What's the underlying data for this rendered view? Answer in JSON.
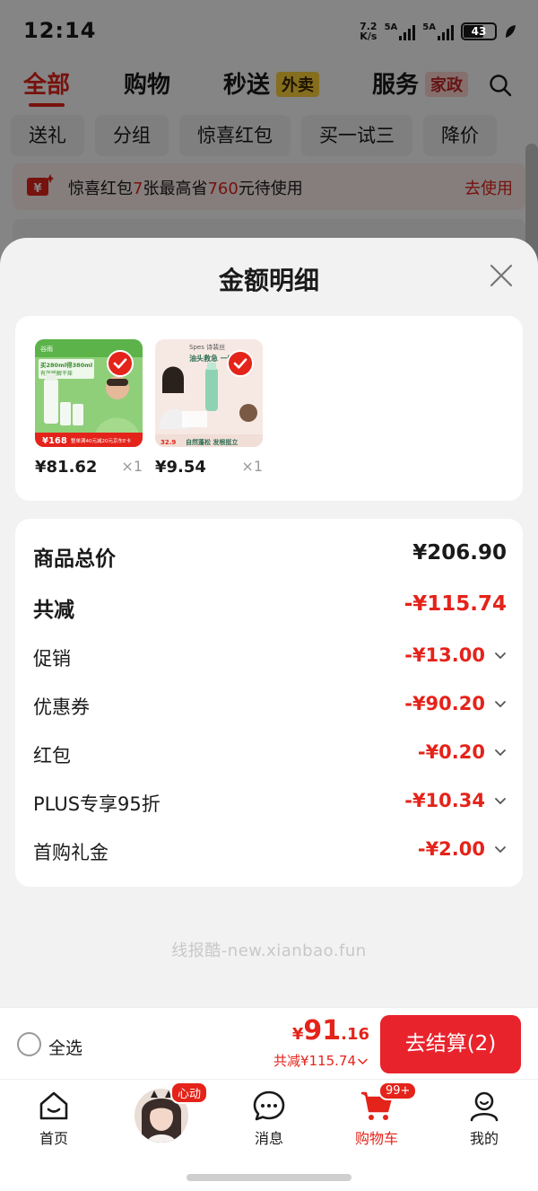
{
  "status_bar": {
    "time": "12:14",
    "net_speed_value": "7.2",
    "net_speed_unit": "K/s",
    "signal1": "5A",
    "signal2": "5A",
    "battery": "43"
  },
  "top_tabs": [
    {
      "label": "全部"
    },
    {
      "label": "购物"
    },
    {
      "label": "秒送"
    },
    {
      "label": "服务"
    }
  ],
  "tab_tags": {
    "waimai": "外卖",
    "jiazheng": "家政"
  },
  "chips": [
    "送礼",
    "分组",
    "惊喜红包",
    "买一试三",
    "降价"
  ],
  "coupon_bar": {
    "text_a": "惊喜红包",
    "count": "7",
    "text_b": "张最高省",
    "amount": "760",
    "text_c": "元待使用",
    "action": "去使用"
  },
  "sheet": {
    "title": "金额明细"
  },
  "goods": [
    {
      "price": "¥81.62",
      "qty": "×1"
    },
    {
      "price": "¥9.54",
      "qty": "×1"
    }
  ],
  "goods_img_text": {
    "g1_brand": "谷雨",
    "g1_line1": "买280ml得380ml",
    "g1_line2": "有效缓解干痒",
    "g1_price": "¥168",
    "g1_promo": "整单满40元减20元京东E卡",
    "g2_brand": "Spes 诗裴丝",
    "g2_headline": "油头救急 一喷蓬松",
    "g2_price": "32.9",
    "g2_footer": "自然蓬松 发根挺立"
  },
  "details": {
    "subtotal_label": "商品总价",
    "subtotal_value": "¥206.90",
    "reduce_label": "共减",
    "reduce_value": "-¥115.74",
    "items": [
      {
        "label": "促销",
        "value": "-¥13.00"
      },
      {
        "label": "优惠券",
        "value": "-¥90.20"
      },
      {
        "label": "红包",
        "value": "-¥0.20"
      },
      {
        "label": "PLUS专享95折",
        "value": "-¥10.34"
      },
      {
        "label": "首购礼金",
        "value": "-¥2.00"
      }
    ]
  },
  "watermark": "线报酷-new.xianbao.fun",
  "checkout": {
    "select_all": "全选",
    "yen": "¥",
    "total_int": "91",
    "total_dec": ".16",
    "reduce": "共减¥115.74",
    "pay_button": "去结算(2)"
  },
  "tabbar": [
    {
      "label": "首页",
      "icon": "home-icon"
    },
    {
      "label": "",
      "icon": "avatar",
      "badge": "心动"
    },
    {
      "label": "消息",
      "icon": "message-icon"
    },
    {
      "label": "购物车",
      "icon": "cart-icon",
      "badge": "99+"
    },
    {
      "label": "我的",
      "icon": "profile-icon"
    }
  ],
  "colors": {
    "accent": "#e4231a",
    "pay_button": "#e8232c"
  }
}
